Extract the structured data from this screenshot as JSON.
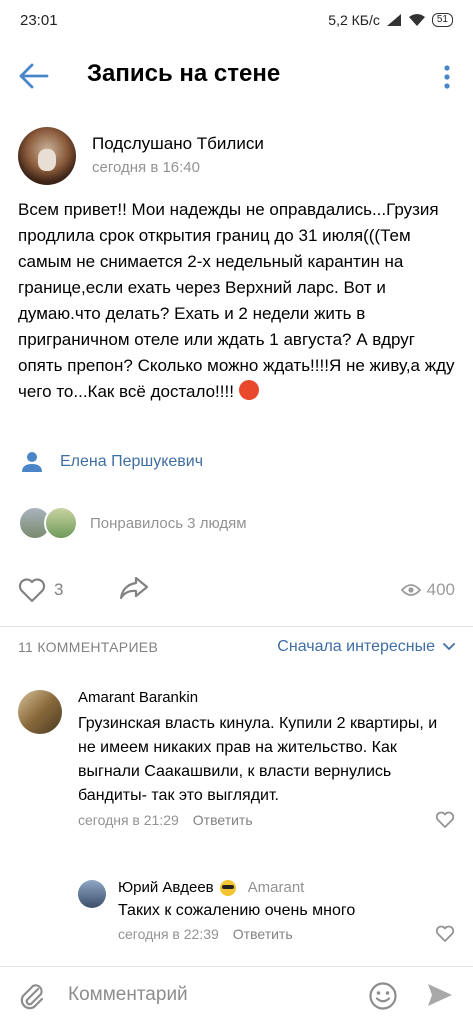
{
  "status": {
    "time": "23:01",
    "speed": "5,2 КБ/с",
    "battery": "51"
  },
  "header": {
    "title": "Запись на стене"
  },
  "post": {
    "group_name": "Подслушано Тбилиси",
    "time": "сегодня в 16:40",
    "text": "Всем привет!! Мои надежды не оправдались...Грузия продлила срок открытия границ до 31 июля(((Тем самым не снимается 2-х недельный карантин на границе,если ехать через Верхний ларс. Вот и думаю.что делать? Ехать и 2 недели жить в приграничном отеле или ждать 1 августа? А вдруг опять препон? Сколько можно ждать!!!!Я не живу,а жду чего то...Как всё достало!!!!",
    "author": "Елена Першукевич",
    "likes_text": "Понравилось 3 людям",
    "like_count": "3",
    "views": "400"
  },
  "comments_section": {
    "count_label": "11 КОММЕНТАРИЕВ",
    "sort_label": "Сначала интересные"
  },
  "comments": [
    {
      "name": "Amarant Barankin",
      "text": "Грузинская власть кинула. Купили 2 квартиры, и не имеем никаких прав на жительство. Как выгнали Саакашвили, к власти вернулись бандиты- так это выглядит.",
      "time": "сегодня в 21:29",
      "reply_label": "Ответить"
    }
  ],
  "reply": {
    "name": "Юрий Авдеев",
    "to": "Amarant",
    "text": "Таких к сожалению очень много",
    "time": "сегодня в 22:39",
    "reply_label": "Ответить"
  },
  "composer": {
    "placeholder": "Комментарий"
  },
  "colors": {
    "accent": "#3f6ea3",
    "icon_blue": "#4a86c7",
    "angry_emoji": "#e8482c"
  },
  "icons": {
    "back": "arrow-left-icon",
    "more": "more-vertical-icon",
    "author": "user-icon",
    "like": "heart-icon",
    "share": "share-icon",
    "views": "eye-icon",
    "dropdown": "chevron-down-icon",
    "attach": "paperclip-icon",
    "emoji": "smile-icon",
    "send": "send-icon"
  }
}
